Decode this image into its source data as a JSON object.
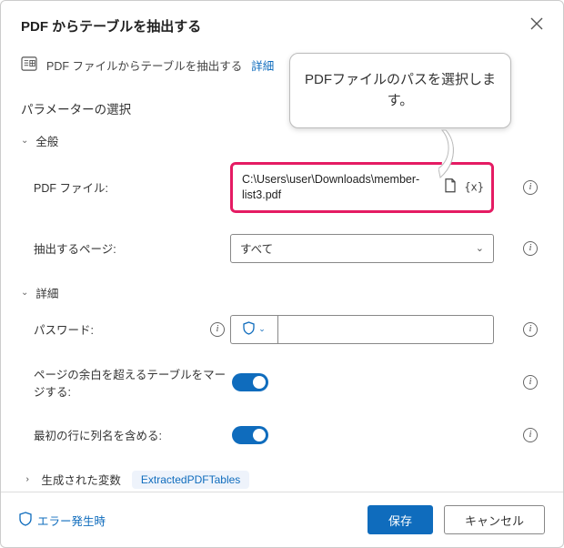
{
  "dialog": {
    "title": "PDF からテーブルを抽出する",
    "info_text": "PDF ファイルからテーブルを抽出する",
    "info_link": "詳細"
  },
  "params": {
    "section_title": "パラメーターの選択",
    "general": {
      "heading": "全般",
      "pdf_file": {
        "label": "PDF ファイル:",
        "value": "C:\\Users\\user\\Downloads\\member-list3.pdf"
      },
      "pages": {
        "label": "抽出するページ:",
        "value": "すべて"
      }
    },
    "advanced": {
      "heading": "詳細",
      "password": {
        "label": "パスワード:"
      },
      "merge_pages": {
        "label": "ページの余白を超えるテーブルをマージする:",
        "on": true
      },
      "header_row": {
        "label": "最初の行に列名を含める:",
        "on": true
      }
    },
    "generated_vars": {
      "label": "生成された変数",
      "chip": "ExtractedPDFTables"
    }
  },
  "footer": {
    "error_link": "エラー発生時",
    "save": "保存",
    "cancel": "キャンセル"
  },
  "callout": {
    "text": "PDFファイルのパスを選択します。"
  },
  "glyphs": {
    "fx": "{x}"
  }
}
